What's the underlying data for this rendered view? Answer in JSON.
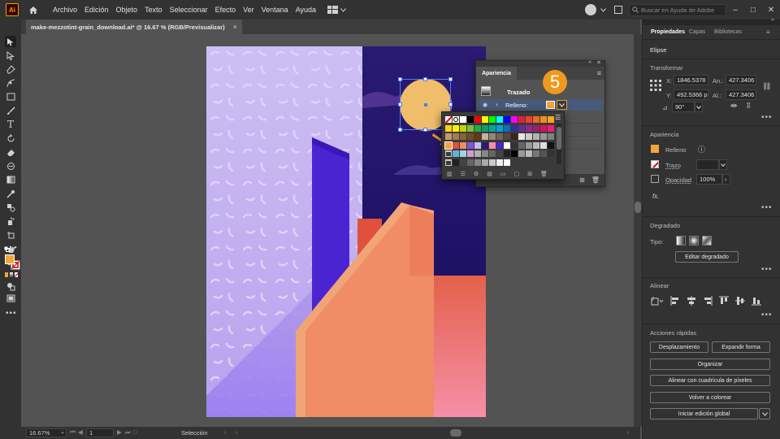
{
  "app": {
    "logo": "Ai",
    "menus": [
      "Archivo",
      "Edición",
      "Objeto",
      "Texto",
      "Seleccionar",
      "Efecto",
      "Ver",
      "Ventana",
      "Ayuda"
    ],
    "search_placeholder": "Buscar en Ayuda de Adobe"
  },
  "document": {
    "tab_title": "make-mezzotint-grain_download.ai* @ 16.67 % (RGB/Previsualizar)",
    "close": "×"
  },
  "status": {
    "zoom": "16.67%",
    "artboard_number": "1",
    "mode": "Selección"
  },
  "appearance_panel": {
    "title": "Apariencia",
    "stroke_label": "Trazado",
    "fill_label": "Relleno:",
    "hidden_row_text": "cto"
  },
  "callout": {
    "number": "5"
  },
  "properties": {
    "tabs": [
      "Propiedades",
      "Capas",
      "Bibliotecas"
    ],
    "object_type": "Elipse",
    "transform": {
      "title": "Transformar",
      "x_label": "X:",
      "x_value": "1846.5378",
      "y_label": "Y:",
      "y_value": "492.5366 p",
      "w_label": "An.:",
      "w_value": "427.3406 p",
      "h_label": "Al.:",
      "h_value": "427.3406 p",
      "angle_value": "90°"
    },
    "appearance": {
      "title": "Apariencia",
      "fill": "Relleno",
      "stroke": "Trazo",
      "opacity_label": "Opacidad",
      "opacity_value": "100%",
      "fx": "fx."
    },
    "gradient": {
      "title": "Degradado",
      "type_label": "Tipo:",
      "edit_button": "Editar degradado"
    },
    "align": {
      "title": "Alinear"
    },
    "quick_actions": {
      "title": "Acciones rápidas",
      "offset": "Desplazamiento",
      "expand": "Expandir forma",
      "arrange": "Organizar",
      "align_pixel": "Alinear con cuadrícula de píxeles",
      "recolor": "Volver a colorear",
      "global_edit": "Iniciar edición global"
    }
  },
  "colors": {
    "accent_orange": "#ee9a1e",
    "fill_swatch": "#f3a43a",
    "sky_dark": "#2a1a72",
    "building_orange": "#f08c66",
    "wall_lavender": "#c8b9f0"
  }
}
